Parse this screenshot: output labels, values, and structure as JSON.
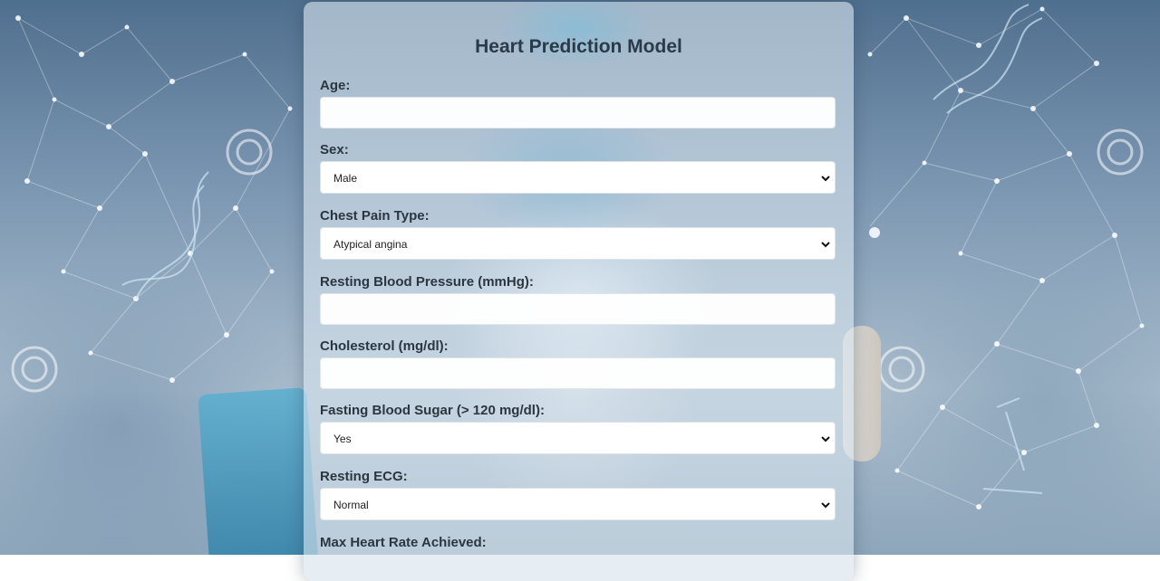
{
  "form": {
    "title": "Heart Prediction Model",
    "fields": [
      {
        "label": "Age:",
        "type": "text",
        "value": ""
      },
      {
        "label": "Sex:",
        "type": "select",
        "value": "Male"
      },
      {
        "label": "Chest Pain Type:",
        "type": "select",
        "value": "Atypical angina"
      },
      {
        "label": "Resting Blood Pressure (mmHg):",
        "type": "text",
        "value": ""
      },
      {
        "label": "Cholesterol (mg/dl):",
        "type": "text",
        "value": ""
      },
      {
        "label": "Fasting Blood Sugar (> 120 mg/dl):",
        "type": "select",
        "value": "Yes"
      },
      {
        "label": "Resting ECG:",
        "type": "select",
        "value": "Normal"
      },
      {
        "label": "Max Heart Rate Achieved:",
        "type": "text",
        "value": ""
      }
    ]
  },
  "icons": {
    "select_arrow": "chevron-down-icon"
  },
  "colors": {
    "title": "#2b3a48",
    "label": "#2b3640",
    "input_bg": "#ffffff"
  }
}
